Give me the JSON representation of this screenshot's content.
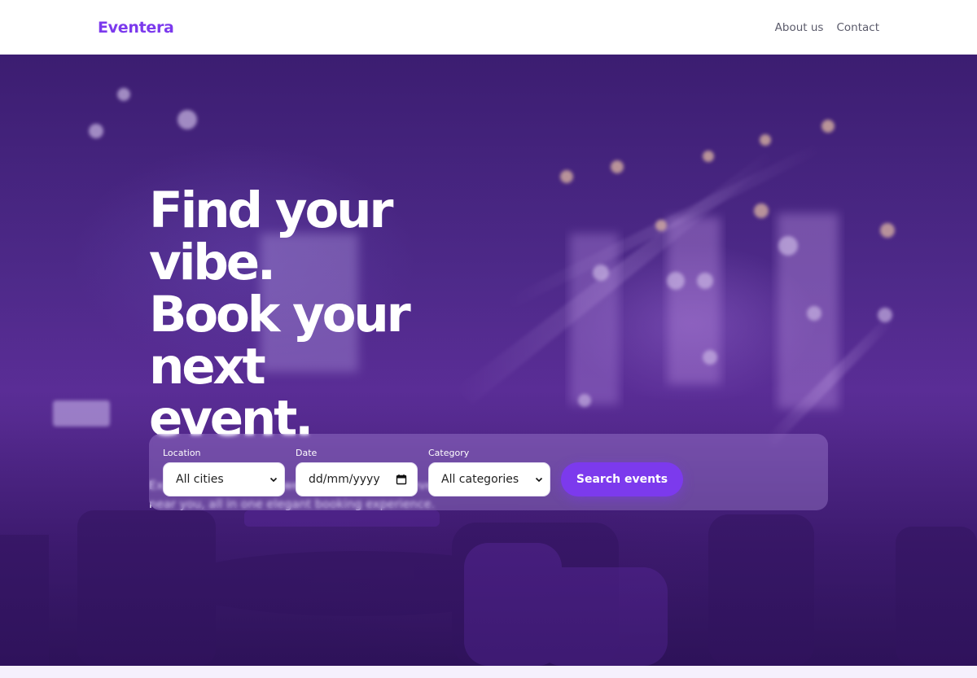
{
  "header": {
    "logo": "Eventera",
    "nav": [
      "About us",
      "Contact"
    ]
  },
  "hero": {
    "title_lines": [
      "Find your vibe.",
      "Book your next",
      "event."
    ],
    "subtitle": "Explore dance, music, wellness and cultural events near you, all in one elegant booking experience."
  },
  "search": {
    "location_label": "Location",
    "location_value": "All cities",
    "date_label": "Date",
    "date_value": "dd/mm/yyyy",
    "category_label": "Category",
    "category_value": "All categories",
    "button_label": "Search events"
  },
  "colors": {
    "accent": "#7c3aed",
    "hero_base": "#4b2a86",
    "nav_text": "#5b5b6b"
  },
  "icons": [
    "chevron-down-icon",
    "calendar-icon"
  ]
}
